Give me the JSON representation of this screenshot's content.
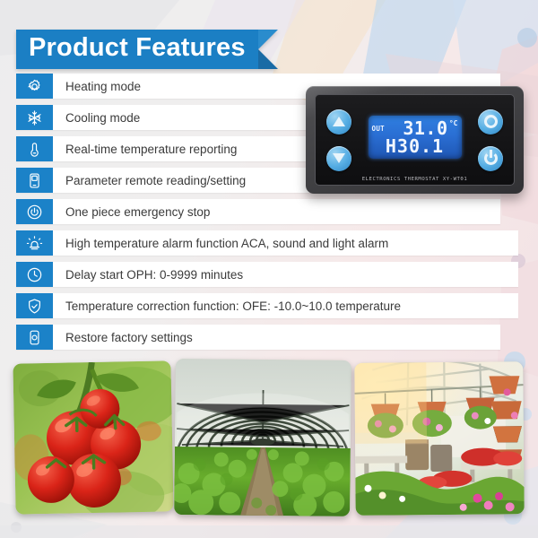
{
  "header": {
    "title": "Product Features",
    "banner_color": "#1b7fc4"
  },
  "theme": {
    "icon_tile_color": "#1b82c8",
    "row_bg": "#ffffff",
    "page_bg": "#ececed",
    "text_color": "#3a3a3a"
  },
  "features": [
    {
      "icon": "sun-gear-icon",
      "label": "Heating mode"
    },
    {
      "icon": "snowflake-icon",
      "label": "Cooling mode"
    },
    {
      "icon": "thermometer-icon",
      "label": "Real-time temperature reporting"
    },
    {
      "icon": "mobile-device-icon",
      "label": "Parameter remote reading/setting"
    },
    {
      "icon": "power-button-icon",
      "label": "One piece emergency stop"
    },
    {
      "icon": "alarm-siren-icon",
      "label": "High temperature alarm function ACA, sound and light alarm"
    },
    {
      "icon": "clock-icon",
      "label": "Delay start OPH: 0-9999 minutes"
    },
    {
      "icon": "shield-check-icon",
      "label": "Temperature correction function: OFE: -10.0~10.0 temperature"
    },
    {
      "icon": "restore-icon",
      "label": "Restore factory settings"
    }
  ],
  "device": {
    "name": "thermostat-module",
    "model_text": "ELECTRONICS THERMOSTAT XY-WT01",
    "display": {
      "channel_label": "OUT",
      "temperature": "31.0",
      "unit": "°C",
      "second_line": "H30.1"
    },
    "buttons": {
      "up": "up-arrow-button",
      "down": "down-arrow-button",
      "set": "set-ring-button",
      "power": "power-button"
    }
  },
  "photos": [
    {
      "name": "photo-tomatoes",
      "caption": "Ripe red tomatoes on the vine"
    },
    {
      "name": "photo-greenhouse",
      "caption": "Polytunnel greenhouse with lettuce rows"
    },
    {
      "name": "photo-nursery",
      "caption": "Sunlit plant nursery with hanging flower pots"
    }
  ]
}
